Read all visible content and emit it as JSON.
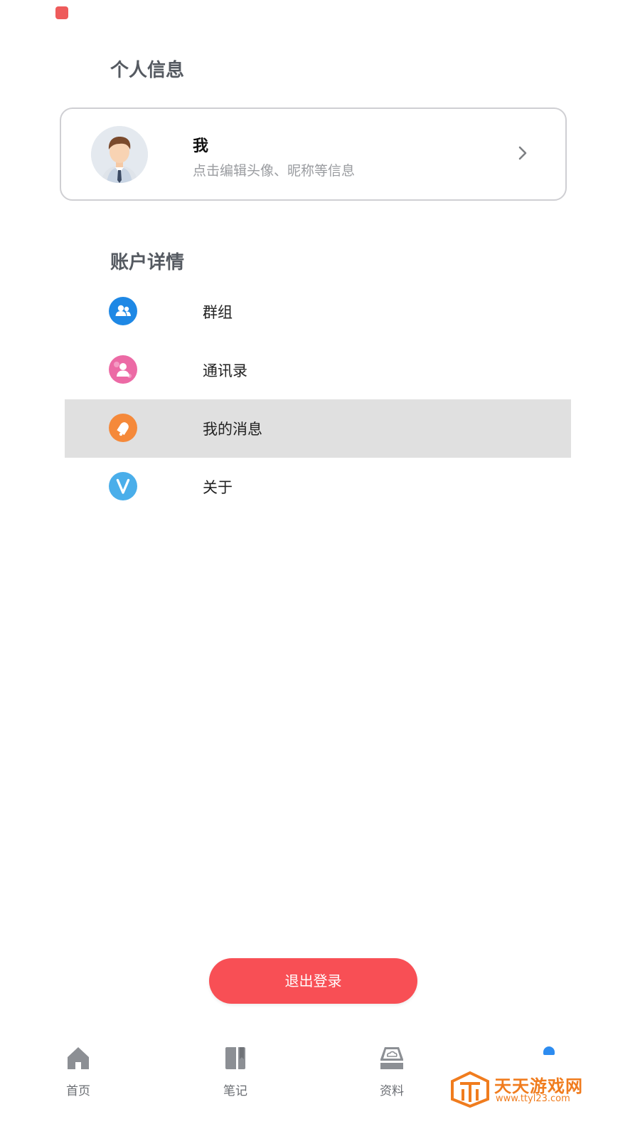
{
  "status_bar": {
    "app_icon": "app-icon"
  },
  "personal_section": {
    "title": "个人信息",
    "profile": {
      "name": "我",
      "hint": "点击编辑头像、昵称等信息",
      "avatar_icon": "user-avatar-icon",
      "chevron_icon": "chevron-right-icon"
    }
  },
  "account_section": {
    "title": "账户详情",
    "items": [
      {
        "label": "群组",
        "icon": "group-icon",
        "color": "#1e88e5",
        "selected": false
      },
      {
        "label": "通讯录",
        "icon": "contacts-icon",
        "color": "#ec6aa5",
        "selected": false
      },
      {
        "label": "我的消息",
        "icon": "bell-icon",
        "color": "#f5893a",
        "selected": true
      },
      {
        "label": "关于",
        "icon": "about-v-icon",
        "color": "#4aaeea",
        "selected": false
      }
    ]
  },
  "logout": {
    "label": "退出登录",
    "color": "#f84f55"
  },
  "tabbar": {
    "tabs": [
      {
        "label": "首页",
        "icon": "home-icon"
      },
      {
        "label": "笔记",
        "icon": "notebook-icon"
      },
      {
        "label": "资料",
        "icon": "cloud-box-icon"
      },
      {
        "label": "",
        "icon": "profile-icon",
        "active": true
      }
    ],
    "active_color": "#2d8cf0"
  },
  "watermark": {
    "text": "天天游戏网",
    "url": "www.ttyl23.com"
  }
}
